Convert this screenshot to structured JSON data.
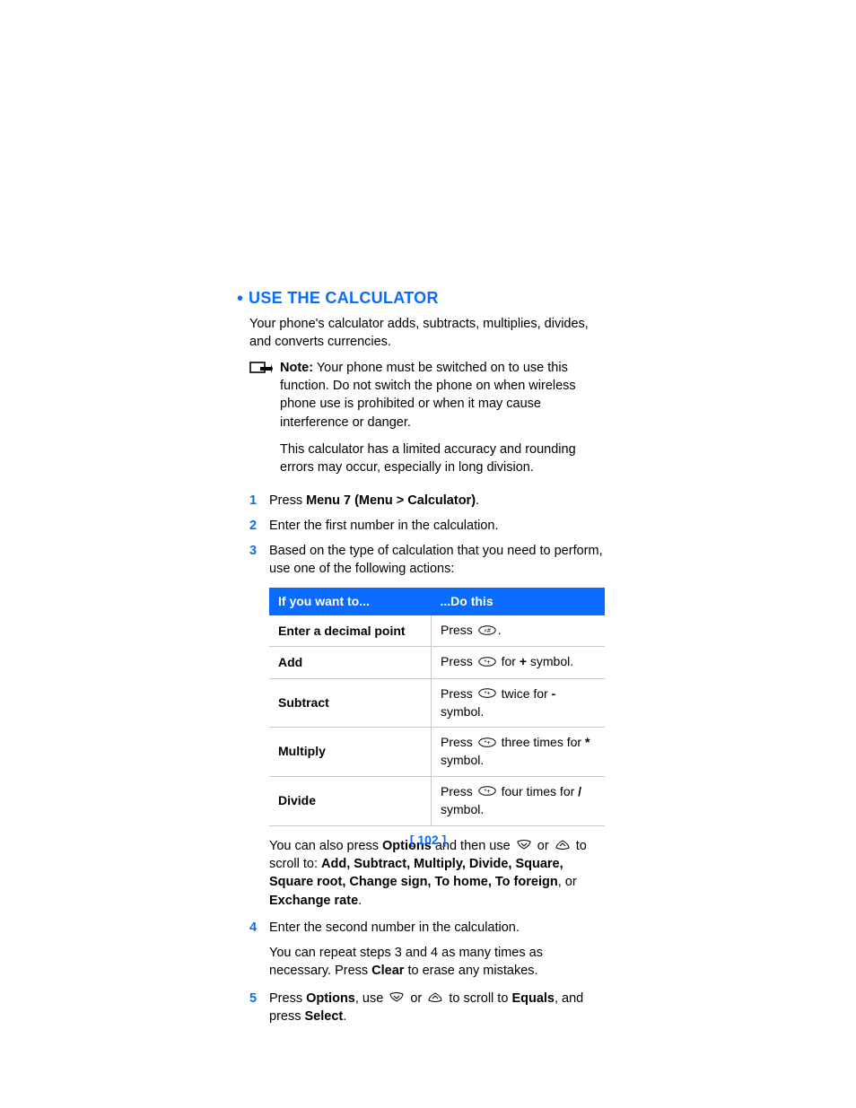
{
  "heading": "USE THE CALCULATOR",
  "intro": "Your phone's calculator adds, subtracts, multiplies, divides, and converts currencies.",
  "note": {
    "label": "Note:",
    "p1": "Your phone must be switched on to use this function. Do not switch the phone on when wireless phone use is prohibited or when it may cause interference or danger.",
    "p2": "This calculator has a limited accuracy and rounding errors may occur, especially in long division."
  },
  "steps": {
    "s1": {
      "num": "1",
      "pre": "Press ",
      "bold": "Menu 7 (Menu > Calculator)",
      "post": "."
    },
    "s2": {
      "num": "2",
      "text": "Enter the first number in the calculation."
    },
    "s3": {
      "num": "3",
      "text": "Based on the type of calculation that you need to perform, use one of the following actions:"
    },
    "s4": {
      "num": "4",
      "text": "Enter the second number in the calculation."
    },
    "s5": {
      "num": "5",
      "a": "Press ",
      "b": "Options",
      "c": ", use ",
      "d": " or ",
      "e": " to scroll to ",
      "f": "Equals",
      "g": ", and press ",
      "h": "Select",
      "i": "."
    }
  },
  "table": {
    "h1": "If you want to...",
    "h2": "...Do this",
    "r1": {
      "want": "Enter a decimal point",
      "a": "Press ",
      "b": "."
    },
    "r2": {
      "want": "Add",
      "a": "Press ",
      "b": " for ",
      "sym": "+",
      "c": " symbol."
    },
    "r3": {
      "want": "Subtract",
      "a": "Press ",
      "b": " twice for ",
      "sym": "-",
      "c": " symbol."
    },
    "r4": {
      "want": "Multiply",
      "a": "Press ",
      "b": " three times for ",
      "sym": "*",
      "c": " symbol."
    },
    "r5": {
      "want": "Divide",
      "a": "Press ",
      "b": " four times for ",
      "sym": "/",
      "c": " symbol."
    }
  },
  "afterTable": {
    "a": "You can also press ",
    "b": "Options",
    "c": " and then use ",
    "d": " or ",
    "e": " to scroll to: ",
    "list": "Add, Subtract, Multiply, Divide, Square, Square root, Change sign, To home, To foreign",
    "f": ", or ",
    "g": "Exchange rate",
    "h": "."
  },
  "repeat": {
    "a": "You can repeat steps 3 and 4 as many times as necessary. Press ",
    "b": "Clear",
    "c": " to erase any mistakes."
  },
  "pageNumber": "[ 102 ]"
}
